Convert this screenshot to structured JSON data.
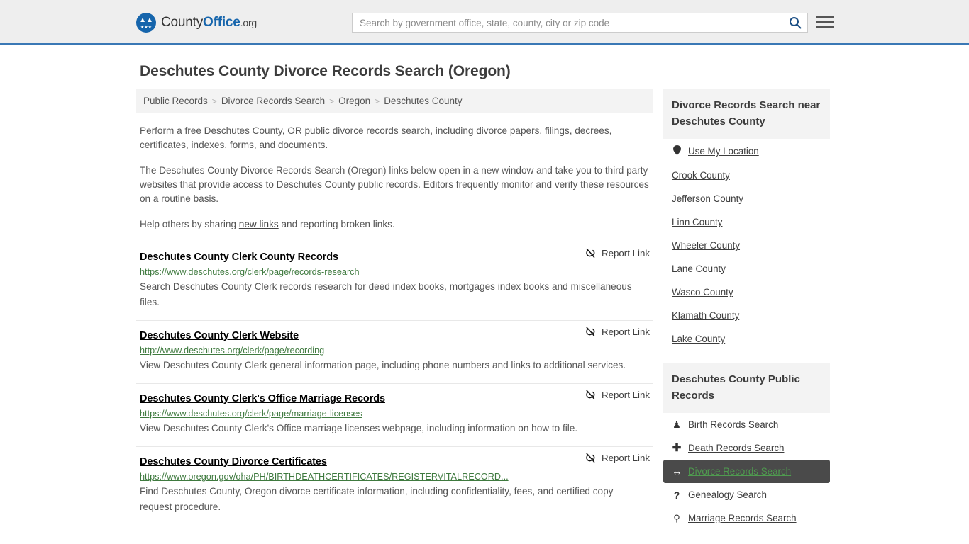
{
  "header": {
    "brand": {
      "part1": "County",
      "part2": "Office",
      "tld": ".org"
    },
    "search": {
      "placeholder": "Search by government office, state, county, city or zip code",
      "value": "",
      "icon": "search-icon"
    },
    "menu_icon": "hamburger-menu-icon"
  },
  "page_title": "Deschutes County Divorce Records Search (Oregon)",
  "breadcrumb": {
    "items": [
      {
        "label": "Public Records",
        "current": false
      },
      {
        "label": "Divorce Records Search",
        "current": false
      },
      {
        "label": "Oregon",
        "current": false
      },
      {
        "label": "Deschutes County",
        "current": true
      }
    ],
    "separator": ">"
  },
  "intro": {
    "p1": "Perform a free Deschutes County, OR public divorce records search, including divorce papers, filings, decrees, certificates, indexes, forms, and documents.",
    "p2": "The Deschutes County Divorce Records Search (Oregon) links below open in a new window and take you to third party websites that provide access to Deschutes County public records. Editors frequently monitor and verify these resources on a routine basis.",
    "p3_before": "Help others by sharing ",
    "p3_link": "new links",
    "p3_after": " and reporting broken links."
  },
  "report_link": {
    "label": "Report Link",
    "icon": "broken-link-icon"
  },
  "results": [
    {
      "title": "Deschutes County Clerk County Records",
      "url": "https://www.deschutes.org/clerk/page/records-research",
      "description": "Search Deschutes County Clerk records research for deed index books, mortgages index books and miscellaneous files."
    },
    {
      "title": "Deschutes County Clerk Website",
      "url": "http://www.deschutes.org/clerk/page/recording",
      "description": "View Deschutes County Clerk general information page, including phone numbers and links to additional services."
    },
    {
      "title": "Deschutes County Clerk's Office Marriage Records",
      "url": "https://www.deschutes.org/clerk/page/marriage-licenses",
      "description": "View Deschutes County Clerk's Office marriage licenses webpage, including information on how to file."
    },
    {
      "title": "Deschutes County Divorce Certificates",
      "url": "https://www.oregon.gov/oha/PH/BIRTHDEATHCERTIFICATES/REGISTERVITALRECORD...",
      "description": "Find Deschutes County, Oregon divorce certificate information, including confidentiality, fees, and certified copy request procedure."
    }
  ],
  "sidebar": {
    "nearby": {
      "heading": "Divorce Records Search near Deschutes County",
      "items": [
        {
          "label": "Use My Location",
          "icon": "map-pin-icon",
          "active": false
        },
        {
          "label": "Crook County",
          "icon": "",
          "active": false
        },
        {
          "label": "Jefferson County",
          "icon": "",
          "active": false
        },
        {
          "label": "Linn County",
          "icon": "",
          "active": false
        },
        {
          "label": "Wheeler County",
          "icon": "",
          "active": false
        },
        {
          "label": "Lane County",
          "icon": "",
          "active": false
        },
        {
          "label": "Wasco County",
          "icon": "",
          "active": false
        },
        {
          "label": "Klamath County",
          "icon": "",
          "active": false
        },
        {
          "label": "Lake County",
          "icon": "",
          "active": false
        }
      ]
    },
    "public_records": {
      "heading": "Deschutes County Public Records",
      "items": [
        {
          "label": "Birth Records Search",
          "icon": "child-icon",
          "glyph": "\u0001",
          "active": false
        },
        {
          "label": "Death Records Search",
          "icon": "cross-icon",
          "glyph": "✚",
          "active": false
        },
        {
          "label": "Divorce Records Search",
          "icon": "left-right-arrow-icon",
          "glyph": "↔",
          "active": true
        },
        {
          "label": "Genealogy Search",
          "icon": "question-mark-icon",
          "glyph": "?",
          "active": false
        },
        {
          "label": "Marriage Records Search",
          "icon": "male-female-icon",
          "glyph": "⚥",
          "active": false
        }
      ]
    }
  },
  "colors": {
    "brand_blue": "#1665ac",
    "header_bg": "#eeeeee",
    "header_border": "#3a78b5",
    "url_green": "#3f7a3f",
    "active_bg": "#4a4a4a",
    "active_link": "#4f9b4f",
    "panel_bg": "#f3f3f3"
  }
}
